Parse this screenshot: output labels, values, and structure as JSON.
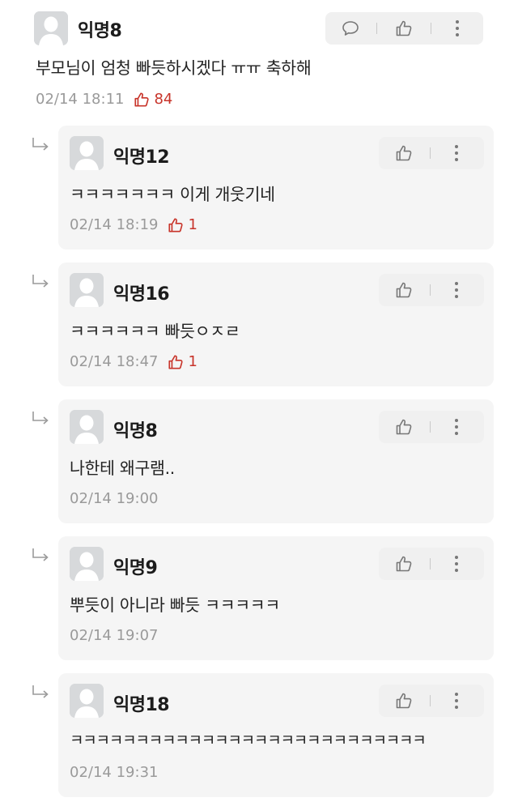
{
  "colors": {
    "accent_like": "#c8342a",
    "meta_gray": "#9a9a9a",
    "card_bg": "#f5f5f5",
    "action_bg": "#f0f0f0"
  },
  "icons": {
    "avatar": "default-avatar-icon",
    "comment": "speech-bubble-icon",
    "like": "thumbs-up-icon",
    "more": "vertical-dots-icon",
    "reply": "reply-arrow-icon"
  },
  "comment": {
    "author": "익명8",
    "text": "부모님이 엄청 빠듯하시겠다 ㅠㅠ 축하해",
    "time": "02/14 18:11",
    "likes": "84"
  },
  "replies": [
    {
      "author": "익명12",
      "text": "ㅋㅋㅋㅋㅋㅋㅋ 이게 개웃기네",
      "time": "02/14 18:19",
      "likes": "1"
    },
    {
      "author": "익명16",
      "text": "ㅋㅋㅋㅋㅋㅋ 빠듯ㅇㅈㄹ",
      "time": "02/14 18:47",
      "likes": "1"
    },
    {
      "author": "익명8",
      "text": "나한테 왜구램..",
      "time": "02/14 19:00"
    },
    {
      "author": "익명9",
      "text": "뿌듯이 아니라 빠듯 ㅋㅋㅋㅋㅋ",
      "time": "02/14 19:07"
    },
    {
      "author": "익명18",
      "text": "ㅋㅋㅋㅋㅋㅋㅋㅋㅋㅋㅋㅋㅋㅋㅋㅋㅋㅋㅋㅋㅋㅋㅋㅋㅋㅋㅋ",
      "time": "02/14 19:31"
    }
  ]
}
